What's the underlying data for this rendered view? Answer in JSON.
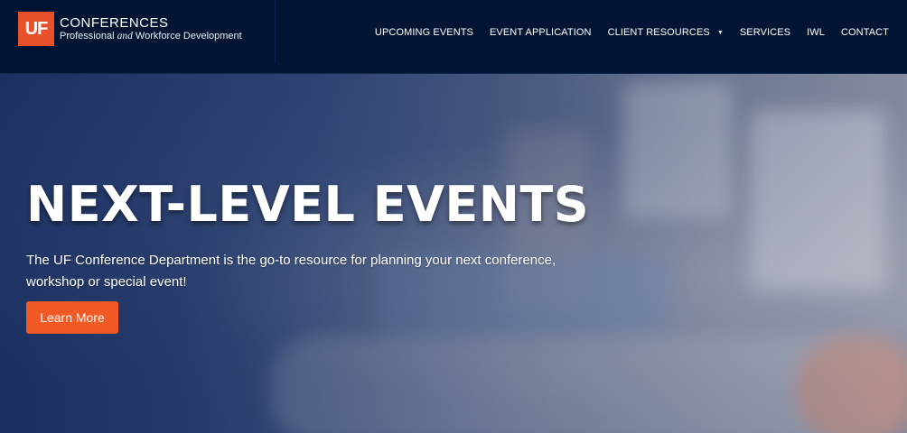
{
  "brand": {
    "logo_text": "UF",
    "title": "CONFERENCES",
    "subtitle_pre": "Professional",
    "subtitle_mid": "and",
    "subtitle_post": "Workforce Development"
  },
  "nav": {
    "items": [
      {
        "label": "UPCOMING EVENTS"
      },
      {
        "label": "EVENT APPLICATION"
      },
      {
        "label": "CLIENT RESOURCES",
        "caret": "▼"
      },
      {
        "label": "SERVICES"
      },
      {
        "label": "IWL"
      },
      {
        "label": "CONTACT"
      }
    ]
  },
  "hero": {
    "title": "NEXT-LEVEL EVENTS",
    "text": "The UF Conference Department is the go-to resource for planning your next conference, workshop or special event!",
    "cta_label": "Learn More"
  },
  "colors": {
    "header_bg": "#021633",
    "accent": "#f15a24",
    "logo_bg": "#e8502a"
  }
}
